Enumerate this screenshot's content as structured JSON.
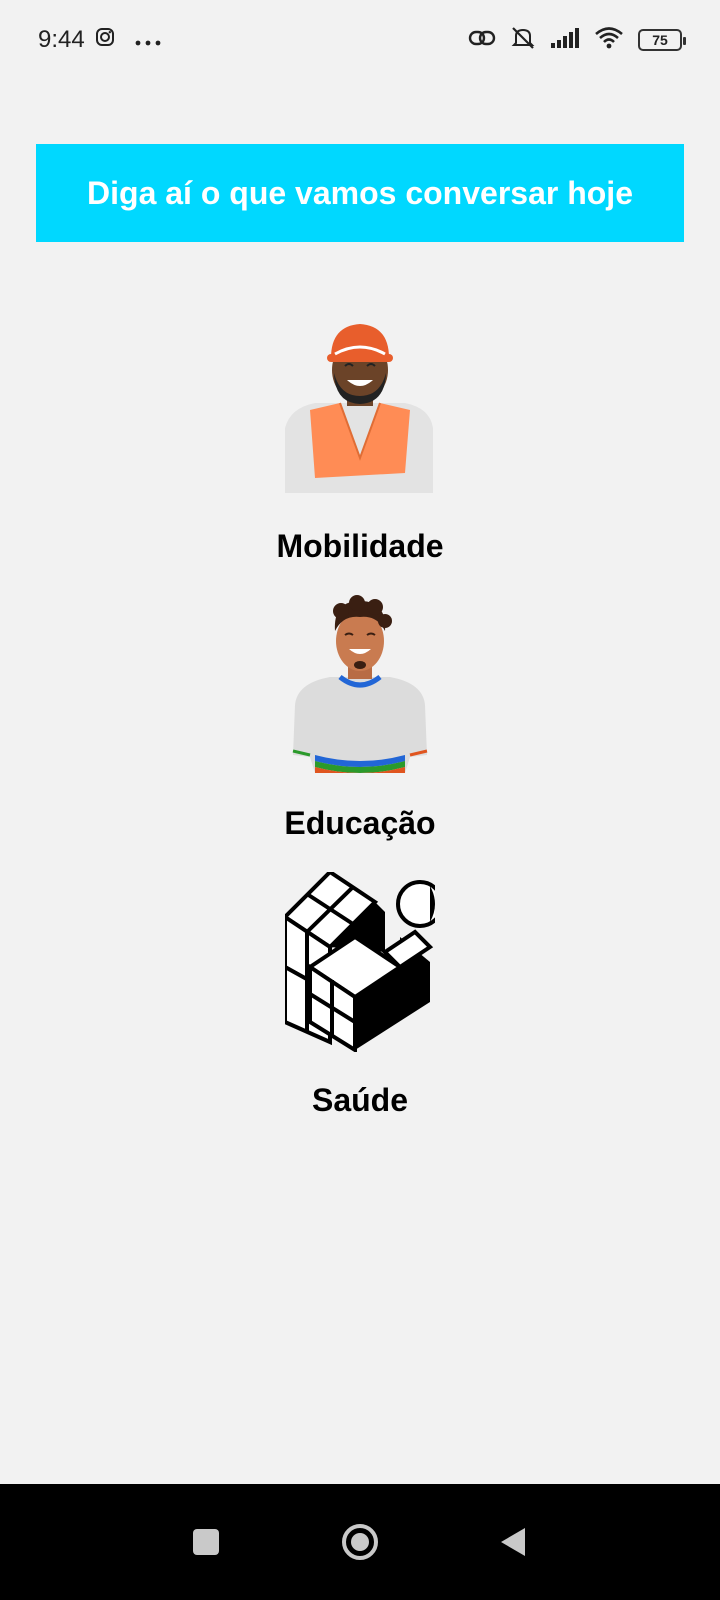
{
  "status_bar": {
    "time": "9:44",
    "battery": "75"
  },
  "banner": {
    "text": "Diga aí o que vamos conversar hoje",
    "color": "#00d8ff"
  },
  "topics": [
    {
      "label": "Mobilidade",
      "icon": "construction-worker-illustration"
    },
    {
      "label": "Educação",
      "icon": "student-illustration"
    },
    {
      "label": "Saúde",
      "icon": "cubes-illustration"
    }
  ],
  "nav": {
    "buttons": [
      "recents-icon",
      "home-icon",
      "back-icon"
    ]
  }
}
